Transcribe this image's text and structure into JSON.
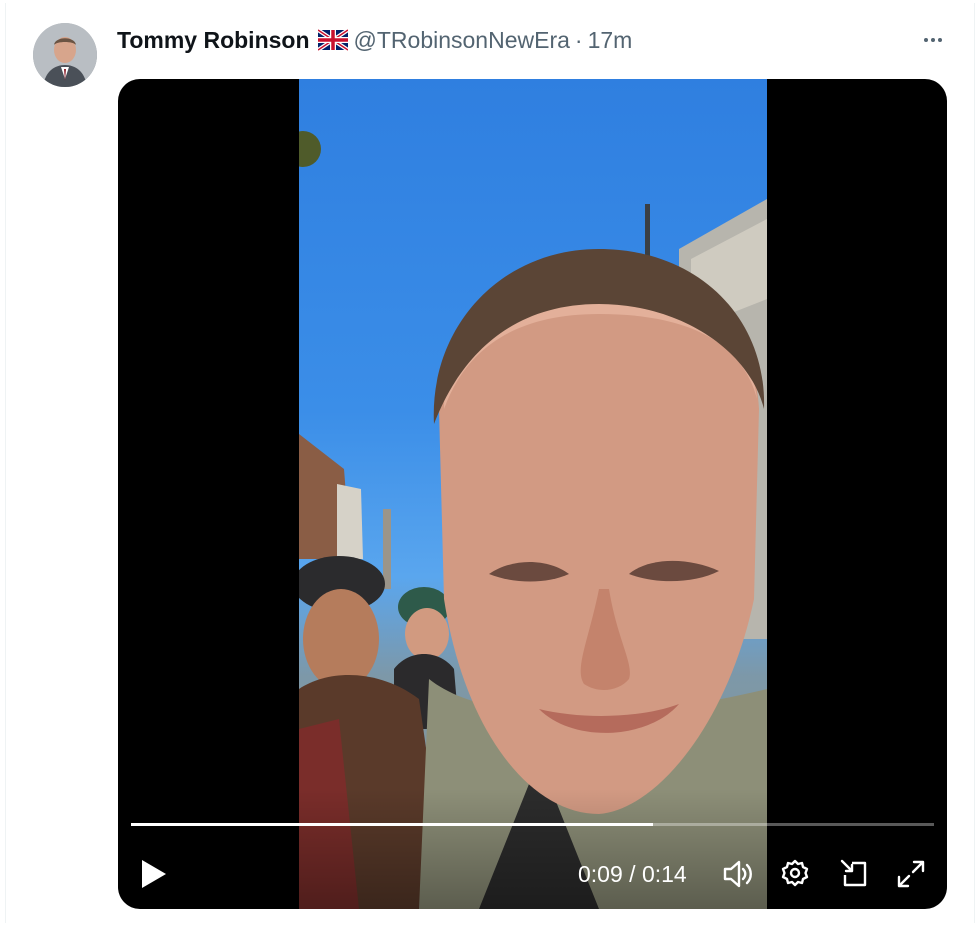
{
  "tweet": {
    "author": {
      "display_name": "Tommy Robinson",
      "flag": "uk-flag-icon",
      "handle": "@TRobinsonNewEra",
      "separator": "·",
      "timestamp": "17m"
    },
    "menu_icon": "more-horizontal-icon"
  },
  "video": {
    "current_time": "0:09",
    "duration": "0:14",
    "time_separator": " / ",
    "progress": 0.65,
    "controls": [
      "play-icon",
      "volume-icon",
      "settings-icon",
      "picture-in-picture-icon",
      "fullscreen-icon"
    ]
  },
  "colors": {
    "text_primary": "#0f1419",
    "text_secondary": "#536471",
    "video_bg": "#000000",
    "control_fg": "#ffffff"
  }
}
